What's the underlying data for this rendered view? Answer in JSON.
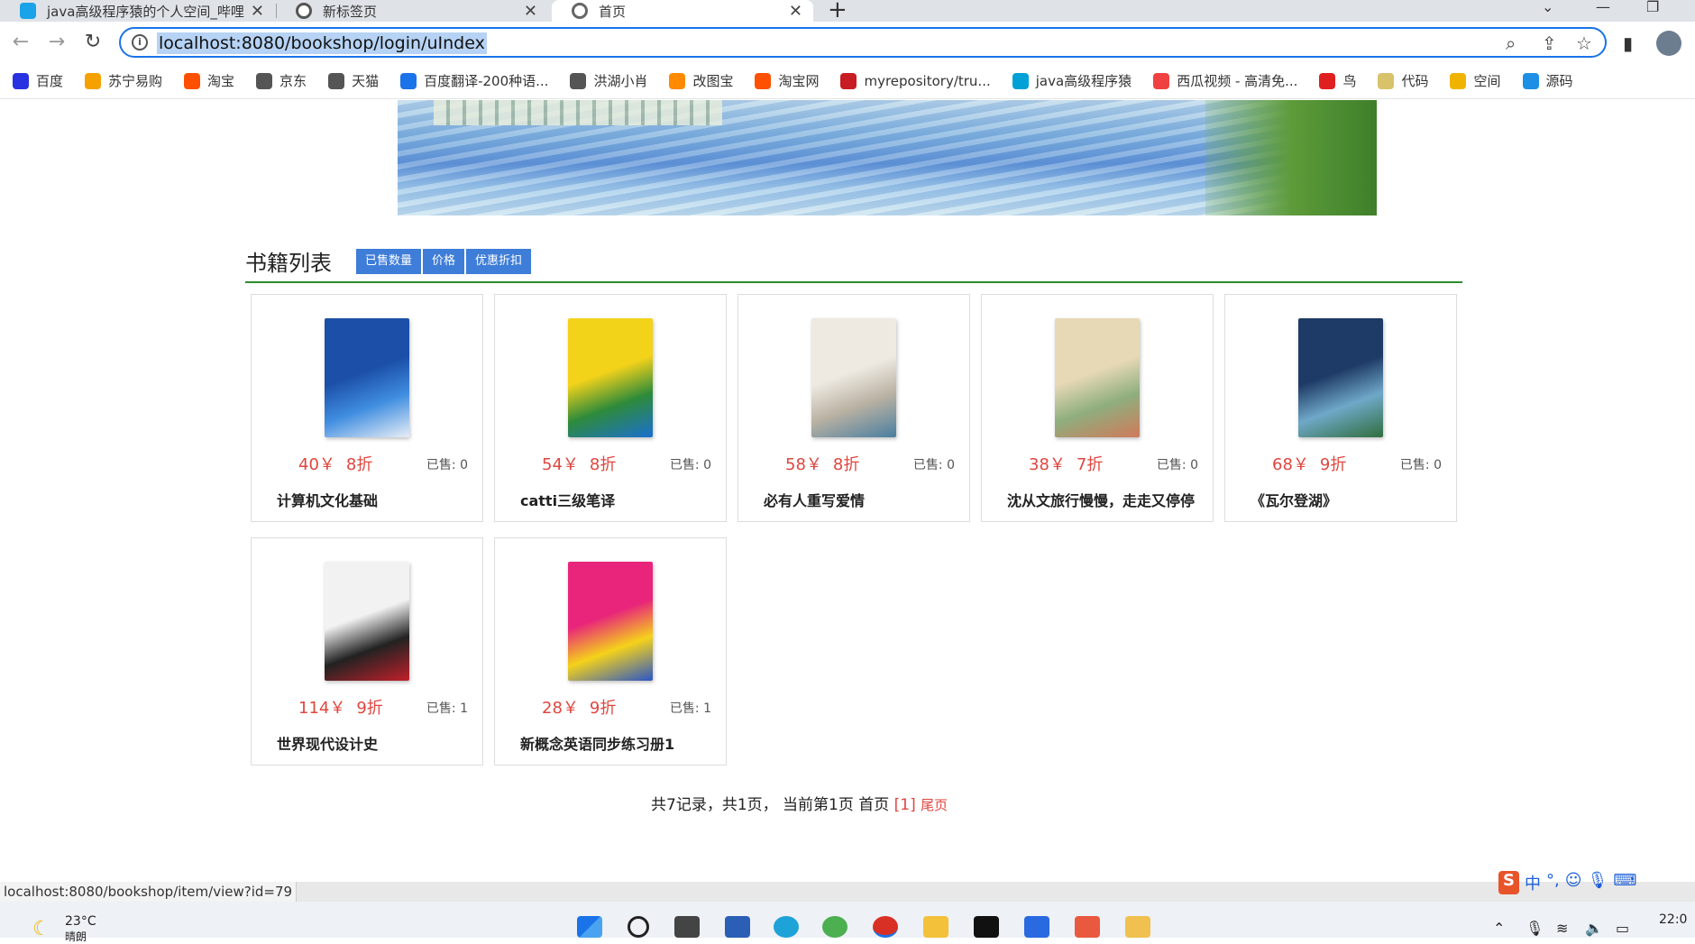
{
  "browser": {
    "tabs": [
      {
        "title": "java高级程序猿的个人空间_哔哩",
        "active": false
      },
      {
        "title": "新标签页",
        "active": false
      },
      {
        "title": "首页",
        "active": true
      }
    ],
    "url": "localhost:8080/bookshop/login/uIndex",
    "bookmarks": [
      {
        "label": "百度",
        "icon": "paw-icon",
        "color": "#2932e1"
      },
      {
        "label": "苏宁易购",
        "icon": "lion-icon",
        "color": "#f5a100"
      },
      {
        "label": "淘宝",
        "icon": "taobao-icon",
        "color": "#ff5000"
      },
      {
        "label": "京东",
        "icon": "globe-icon",
        "color": "#555555"
      },
      {
        "label": "天猫",
        "icon": "globe-icon",
        "color": "#555555"
      },
      {
        "label": "百度翻译-200种语...",
        "icon": "translate-icon",
        "color": "#1a73e8"
      },
      {
        "label": "洪湖小肖",
        "icon": "bird-icon",
        "color": "#555555"
      },
      {
        "label": "改图宝",
        "icon": "image-icon",
        "color": "#ff8a00"
      },
      {
        "label": "淘宝网",
        "icon": "taobao-icon",
        "color": "#ff5000"
      },
      {
        "label": "myrepository/tru...",
        "icon": "gitee-icon",
        "color": "#c71d23"
      },
      {
        "label": "java高级程序猿",
        "icon": "bilibili-icon",
        "color": "#00a1d6"
      },
      {
        "label": "西瓜视频 - 高清免...",
        "icon": "play-icon",
        "color": "#f04142"
      },
      {
        "label": "鸟",
        "icon": "bird-icon",
        "color": "#e02020"
      },
      {
        "label": "代码",
        "icon": "folder-icon",
        "color": "#d8c26a"
      },
      {
        "label": "空间",
        "icon": "star-icon",
        "color": "#f0b400"
      },
      {
        "label": "源码",
        "icon": "docker-icon",
        "color": "#1d90e6"
      }
    ]
  },
  "section": {
    "title": "书籍列表",
    "sort_buttons": [
      "已售数量",
      "价格",
      "优惠折扣"
    ]
  },
  "books": [
    {
      "name": "计算机文化基础",
      "price": "40￥",
      "discount": "8折",
      "sold": "已售: 0",
      "cover_colors": [
        "#1b4fa8",
        "#3f8de0",
        "#e8eef6"
      ]
    },
    {
      "name": "catti三级笔译",
      "price": "54￥",
      "discount": "8折",
      "sold": "已售: 0",
      "cover_colors": [
        "#f3d21a",
        "#2e8b3a",
        "#1b6fd0"
      ]
    },
    {
      "name": "必有人重写爱情",
      "price": "58￥",
      "discount": "8折",
      "sold": "已售: 0",
      "cover_colors": [
        "#eeeae2",
        "#b9b1a2",
        "#4a7ea0"
      ]
    },
    {
      "name": "沈从文旅行慢慢，走走又停停",
      "price": "38￥",
      "discount": "7折",
      "sold": "已售: 0",
      "cover_colors": [
        "#e7d9b6",
        "#8fae7e",
        "#d07a5a"
      ]
    },
    {
      "name": "《瓦尔登湖》",
      "price": "68￥",
      "discount": "9折",
      "sold": "已售: 0",
      "cover_colors": [
        "#1e3a66",
        "#6fa8c8",
        "#2f6e3e"
      ]
    },
    {
      "name": "世界现代设计史",
      "price": "114￥",
      "discount": "9折",
      "sold": "已售: 1",
      "cover_colors": [
        "#f2f2f2",
        "#222222",
        "#c0202a"
      ]
    },
    {
      "name": "新概念英语同步练习册1",
      "price": "28￥",
      "discount": "9折",
      "sold": "已售: 1",
      "cover_colors": [
        "#e8257a",
        "#f5d21a",
        "#2a55c8"
      ]
    }
  ],
  "pager": {
    "summary": "共7记录，共1页， 当前第1页 首页",
    "current": "[1]",
    "last": "尾页"
  },
  "status_url": "localhost:8080/bookshop/item/view?id=79",
  "taskbar": {
    "temperature": "23°C",
    "weather": "晴朗",
    "clock": "22:0"
  },
  "ime": {
    "logo": "S",
    "mode": "中"
  }
}
